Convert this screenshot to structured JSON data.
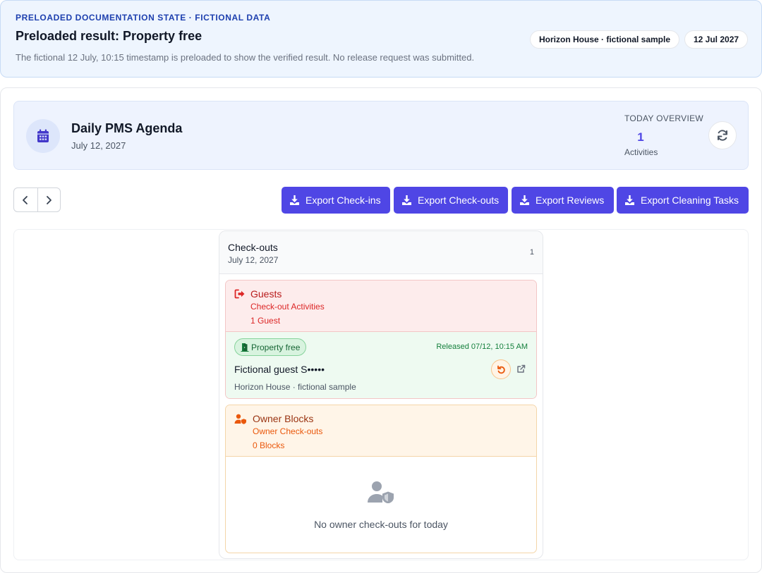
{
  "banner": {
    "eyebrow": "PRELOADED DOCUMENTATION STATE · FICTIONAL DATA",
    "title": "Preloaded result: Property free",
    "description": "The fictional 12 July, 10:15 timestamp is preloaded to show the verified result. No release request was submitted.",
    "chips": {
      "sample": "Horizon House · fictional sample",
      "date": "12 Jul 2027"
    }
  },
  "agenda": {
    "icon": "calendar-icon",
    "title": "Daily PMS Agenda",
    "date": "July 12, 2027",
    "overview": {
      "label": "TODAY OVERVIEW",
      "count": "1",
      "unit": "Activities"
    },
    "refresh_icon": "refresh-icon"
  },
  "nav": {
    "prev_icon": "chevron-left-icon",
    "next_icon": "chevron-right-icon"
  },
  "exports": {
    "checkins": "Export Check-ins",
    "checkouts": "Export Check-outs",
    "reviews": "Export Reviews",
    "cleaning": "Export Cleaning Tasks",
    "icon": "download-icon"
  },
  "column": {
    "title": "Check-outs",
    "date": "July 12, 2027",
    "count": "1",
    "guests": {
      "title": "Guests",
      "subtitle": "Check-out Activities",
      "count": "1 Guest",
      "icon": "sign-out-icon",
      "booking": {
        "status": "Property free",
        "status_icon": "door-open-icon",
        "released": "Released 07/12, 10:15 AM",
        "guest_name": "Fictional guest S•••••",
        "property": "Horizon House · fictional sample",
        "undo_icon": "undo-icon",
        "open_icon": "external-link-icon"
      }
    },
    "owners": {
      "title": "Owner Blocks",
      "subtitle": "Owner Check-outs",
      "count": "0 Blocks",
      "icon": "user-shield-icon",
      "empty_text": "No owner check-outs for today"
    }
  },
  "colors": {
    "accent": "#4f46e5",
    "danger": "#dc2626",
    "success": "#15803d",
    "warning": "#ea580c"
  }
}
